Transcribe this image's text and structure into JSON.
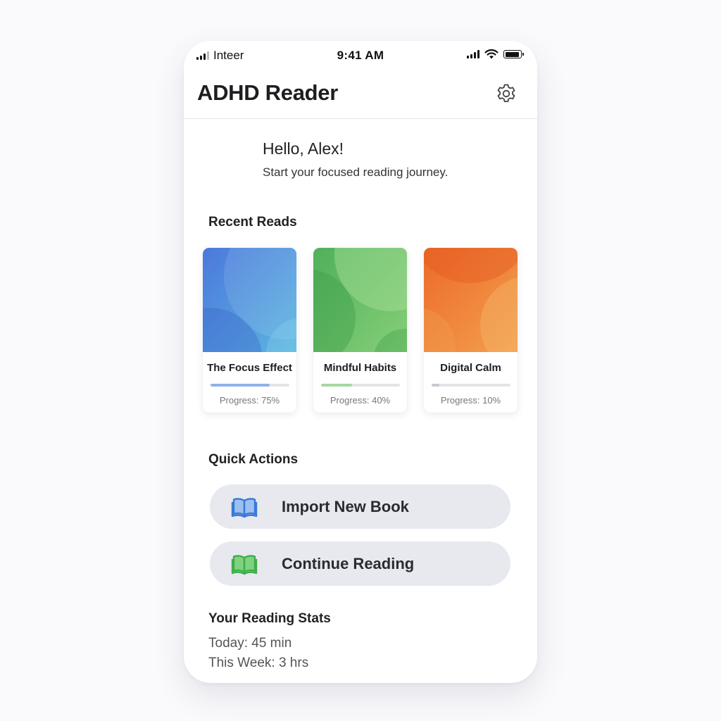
{
  "status_bar": {
    "carrier": "Inteer",
    "time": "9:41 AM"
  },
  "header": {
    "title": "ADHD Reader",
    "settings_icon": "gear-icon"
  },
  "greeting": {
    "title": "Hello, Alex!",
    "subtitle": "Start your focused reading journey."
  },
  "recent_reads": {
    "title": "Recent Reads",
    "books": [
      {
        "title": "The Focus Effect",
        "progress_label": "Progress: 75%",
        "progress": 0.75,
        "accent": "#4a7fdc",
        "bar_color": "#8fb2e8"
      },
      {
        "title": "Mindful Habits",
        "progress_label": "Progress: 40%",
        "progress": 0.4,
        "accent": "#5cb85c",
        "bar_color": "#a7d8a0"
      },
      {
        "title": "Digital Calm",
        "progress_label": "Progress: 10%",
        "progress": 0.1,
        "accent": "#ee7a2e",
        "bar_color": "#c9c9cf"
      }
    ]
  },
  "quick_actions": {
    "title": "Quick Actions",
    "import_label": "Import New Book",
    "import_icon": "open-book-icon",
    "import_color": "#3a78d8",
    "continue_label": "Continue Reading",
    "continue_icon": "open-book-icon",
    "continue_color": "#3fae4a"
  },
  "stats": {
    "title": "Your Reading Stats",
    "today": "Today: 45 min",
    "week": "This Week: 3 hrs"
  }
}
